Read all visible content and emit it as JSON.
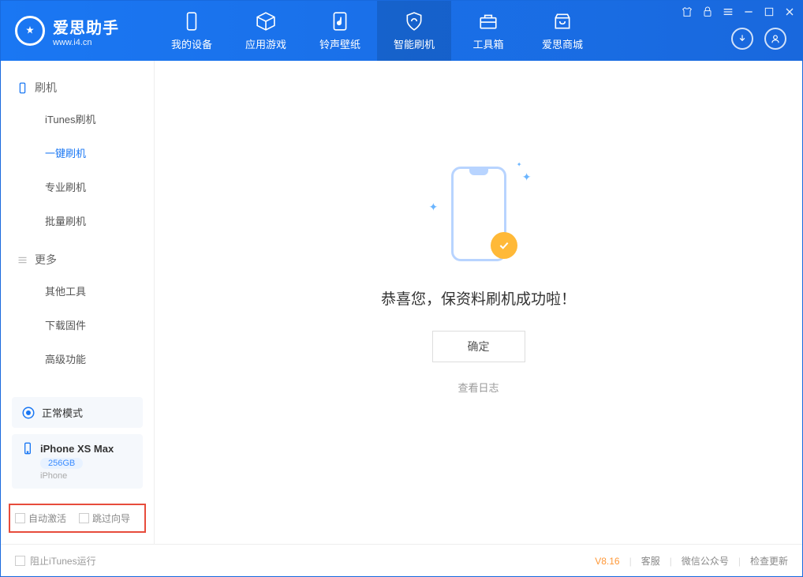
{
  "app": {
    "title": "爱思助手",
    "subtitle": "www.i4.cn"
  },
  "nav": {
    "tabs": [
      {
        "label": "我的设备"
      },
      {
        "label": "应用游戏"
      },
      {
        "label": "铃声壁纸"
      },
      {
        "label": "智能刷机"
      },
      {
        "label": "工具箱"
      },
      {
        "label": "爱思商城"
      }
    ]
  },
  "sidebar": {
    "section1_title": "刷机",
    "section1_items": [
      {
        "label": "iTunes刷机"
      },
      {
        "label": "一键刷机"
      },
      {
        "label": "专业刷机"
      },
      {
        "label": "批量刷机"
      }
    ],
    "section2_title": "更多",
    "section2_items": [
      {
        "label": "其他工具"
      },
      {
        "label": "下载固件"
      },
      {
        "label": "高级功能"
      }
    ]
  },
  "device_mode": {
    "label": "正常模式"
  },
  "device_info": {
    "name": "iPhone XS Max",
    "storage": "256GB",
    "type": "iPhone"
  },
  "bottom_options": {
    "auto_activate": "自动激活",
    "skip_guide": "跳过向导"
  },
  "main": {
    "success_message": "恭喜您，保资料刷机成功啦！",
    "ok_button": "确定",
    "view_log": "查看日志"
  },
  "footer": {
    "block_itunes": "阻止iTunes运行",
    "version": "V8.16",
    "support": "客服",
    "wechat": "微信公众号",
    "check_update": "检查更新"
  }
}
